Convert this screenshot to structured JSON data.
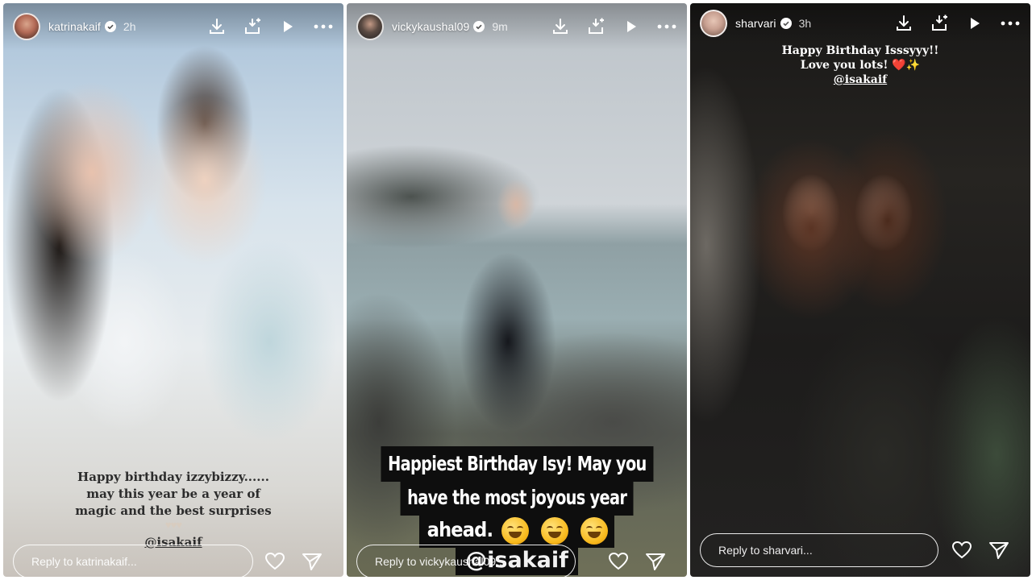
{
  "stories": [
    {
      "username": "katrinakaif",
      "time_ago": "2h",
      "caption_lines": [
        "Happy birthday izzybizzy......",
        "may this year be a year of",
        "magic and the best surprises"
      ],
      "mention": "@isakaif",
      "reply_placeholder": "Reply to katrinakaif..."
    },
    {
      "username": "vickykaushal09",
      "time_ago": "9m",
      "banner_lines": [
        "Happiest Birthday Isy! May you",
        "have the most joyous year",
        "ahead."
      ],
      "mention": "@isakaif",
      "reply_placeholder": "Reply to vickykaushal09..."
    },
    {
      "username": "sharvari",
      "time_ago": "3h",
      "caption_lines": [
        "Happy Birthday Isssyyy!!",
        "Love you lots! ❤️✨"
      ],
      "mention": "@isakaif",
      "reply_placeholder": "Reply to sharvari..."
    }
  ],
  "icons": {
    "verified": "verified-badge-icon",
    "download": "download-icon",
    "add_to_collection": "add-to-story-icon",
    "play": "play-icon",
    "more": "more-options-icon",
    "like": "heart-icon",
    "share": "send-icon"
  },
  "colors": {
    "verified_badge": "#ffffff",
    "text_white": "#ffffff"
  }
}
